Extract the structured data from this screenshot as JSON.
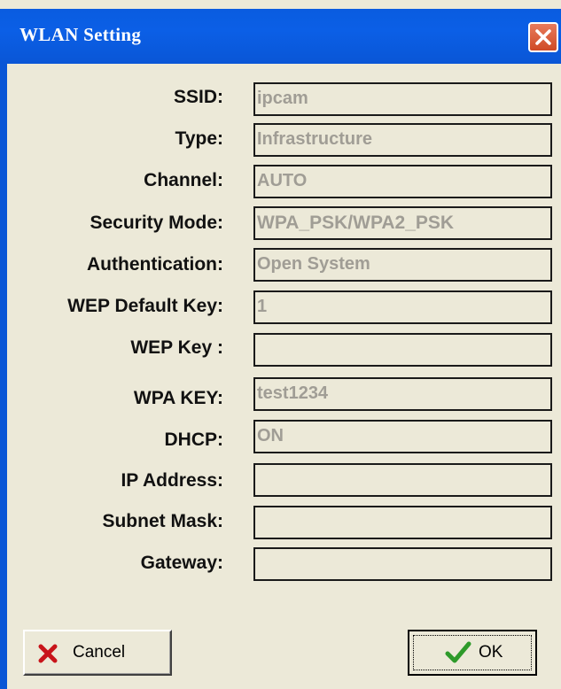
{
  "window": {
    "title": "WLAN Setting"
  },
  "form": {
    "fields": [
      {
        "label": "SSID:",
        "value": "ipcam"
      },
      {
        "label": "Type:",
        "value": "Infrastructure"
      },
      {
        "label": "Channel:",
        "value": "AUTO"
      },
      {
        "label": "Security Mode:",
        "value": "WPA_PSK/WPA2_PSK"
      },
      {
        "label": "Authentication:",
        "value": "Open System"
      },
      {
        "label": "WEP Default Key:",
        "value": "1"
      },
      {
        "label": "WEP Key :",
        "value": ""
      },
      {
        "label": "WPA KEY:",
        "value": "test1234"
      },
      {
        "label": "DHCP:",
        "value": "ON"
      },
      {
        "label": "IP Address:",
        "value": ""
      },
      {
        "label": "Subnet Mask:",
        "value": ""
      },
      {
        "label": "Gateway:",
        "value": ""
      }
    ]
  },
  "buttons": {
    "cancel_label": "Cancel",
    "ok_label": "OK"
  },
  "icons": {
    "close": "close-x-icon",
    "cancel": "red-x-icon",
    "ok": "green-check-icon"
  }
}
